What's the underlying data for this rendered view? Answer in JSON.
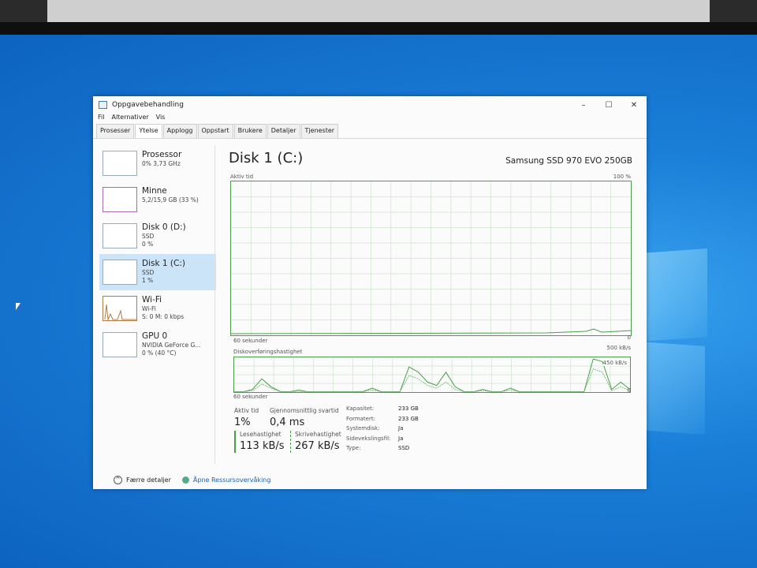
{
  "window": {
    "title": "Oppgavebehandling",
    "controls": [
      "–",
      "☐",
      "✕"
    ],
    "menu": [
      "Fil",
      "Alternativer",
      "Vis"
    ],
    "tabs": [
      "Prosesser",
      "Ytelse",
      "Applogg",
      "Oppstart",
      "Brukere",
      "Detaljer",
      "Tjenester"
    ],
    "active_tab": "Ytelse"
  },
  "sidebar": {
    "items": [
      {
        "name": "Prosessor",
        "line1": "0% 3,73 GHz",
        "line2": ""
      },
      {
        "name": "Minne",
        "line1": "5,2/15,9 GB (33 %)",
        "line2": ""
      },
      {
        "name": "Disk 0 (D:)",
        "line1": "SSD",
        "line2": "0 %"
      },
      {
        "name": "Disk 1 (C:)",
        "line1": "SSD",
        "line2": "1 %"
      },
      {
        "name": "Wi-Fi",
        "line1": "Wi-Fi",
        "line2": "S: 0 M: 0 kbps"
      },
      {
        "name": "GPU 0",
        "line1": "NVIDIA GeForce G...",
        "line2": "0 % (40 °C)"
      }
    ],
    "selected": "Disk 1 (C:)"
  },
  "main": {
    "title": "Disk 1 (C:)",
    "model": "Samsung SSD 970 EVO 250GB",
    "graph1": {
      "label": "Aktiv tid",
      "max": "100 %",
      "time": "60 sekunder",
      "min": "0"
    },
    "graph2": {
      "label": "Diskoverføringshastighet",
      "max": "500 kB/s",
      "mid": "450 kB/s",
      "time": "60 sekunder",
      "min": "0"
    },
    "stats": {
      "active_label": "Aktiv tid",
      "active_value": "1%",
      "resp_label": "Gjennomsnittlig svartid",
      "resp_value": "0,4 ms",
      "read_label": "Lesehastighet",
      "read_value": "113 kB/s",
      "write_label": "Skrivehastighet",
      "write_value": "267 kB/s"
    },
    "props": [
      {
        "k": "Kapasitet:",
        "v": "233 GB"
      },
      {
        "k": "Formatert:",
        "v": "233 GB"
      },
      {
        "k": "Systemdisk:",
        "v": "Ja"
      },
      {
        "k": "Sidevekslingsfil:",
        "v": "Ja"
      },
      {
        "k": "Type:",
        "v": "SSD"
      }
    ]
  },
  "footer": {
    "fewer_details": "Færre detaljer",
    "open_monitor": "Åpne Ressursovervåking"
  },
  "chart_data": {
    "type": "line",
    "transfer_rate_read": [
      5,
      5,
      40,
      200,
      80,
      10,
      5,
      30,
      5,
      5,
      5,
      5,
      5,
      5,
      10,
      60,
      5,
      5,
      5,
      380,
      300,
      150,
      100,
      300,
      80,
      5,
      5,
      40,
      5,
      5,
      60,
      5,
      5,
      5,
      5,
      5,
      5,
      5,
      5,
      500,
      460,
      40,
      150,
      40
    ],
    "transfer_rate_write": [
      5,
      5,
      20,
      120,
      60,
      5,
      5,
      10,
      5,
      5,
      5,
      5,
      5,
      5,
      5,
      30,
      5,
      5,
      5,
      250,
      200,
      100,
      60,
      150,
      40,
      5,
      5,
      20,
      5,
      5,
      30,
      5,
      5,
      5,
      5,
      5,
      5,
      5,
      5,
      350,
      300,
      20,
      80,
      20
    ],
    "ylim": [
      0,
      500
    ]
  }
}
